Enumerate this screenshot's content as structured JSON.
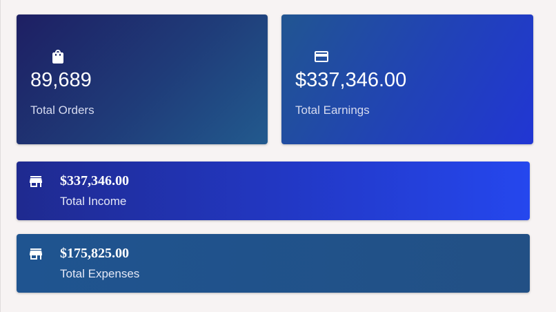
{
  "cards": {
    "orders": {
      "icon": "shopping-bag-icon",
      "value": "89,689",
      "label": "Total Orders"
    },
    "earnings": {
      "icon": "credit-card-icon",
      "value": "$337,346.00",
      "label": "Total Earnings"
    },
    "income": {
      "icon": "store-icon",
      "value": "$337,346.00",
      "label": "Total Income"
    },
    "expenses": {
      "icon": "store-icon",
      "value": "$175,825.00",
      "label": "Total Expenses"
    }
  },
  "colors": {
    "background": "#f7f3f3",
    "orders_gradient": [
      "#1e1f63",
      "#225a8e"
    ],
    "earnings_gradient": [
      "#215591",
      "#2136d4"
    ],
    "income_gradient": [
      "#1f2a8f",
      "#2547ee"
    ],
    "expenses_color": "#215289"
  }
}
